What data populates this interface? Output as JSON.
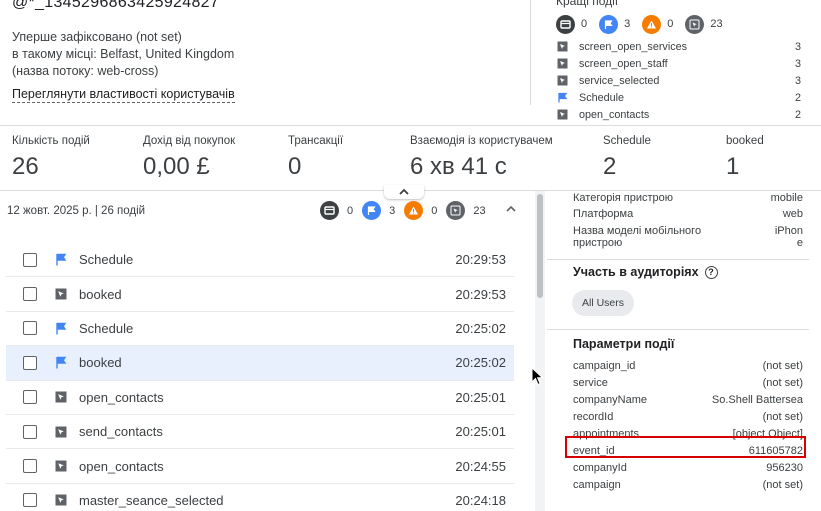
{
  "profile": {
    "user_id": "@*_1345296863425924827",
    "first_seen_line1": "Уперше зафіксовано (not set)",
    "first_seen_line2": "в такому місці: Belfast, United Kingdom",
    "first_seen_line3": "(назва потоку: web-cross)",
    "view_properties_link": "Переглянути властивості користувачів"
  },
  "top_events": {
    "title": "Кращі події",
    "counters": [
      {
        "icon": "screen-icon",
        "value": "0"
      },
      {
        "icon": "flag-icon",
        "value": "3"
      },
      {
        "icon": "warning-icon",
        "value": "0"
      },
      {
        "icon": "cursor-icon",
        "value": "23"
      }
    ],
    "items": [
      {
        "icon": "cursor-icon",
        "name": "screen_open_services",
        "count": "3"
      },
      {
        "icon": "cursor-icon",
        "name": "screen_open_staff",
        "count": "3"
      },
      {
        "icon": "cursor-icon",
        "name": "service_selected",
        "count": "3"
      },
      {
        "icon": "flag-icon",
        "name": "Schedule",
        "count": "2"
      },
      {
        "icon": "cursor-icon",
        "name": "open_contacts",
        "count": "2"
      }
    ]
  },
  "metrics": [
    {
      "label": "Кількість подій",
      "value": "26"
    },
    {
      "label": "Дохід від покупок",
      "value": "0,00 £"
    },
    {
      "label": "Трансакції",
      "value": "0"
    },
    {
      "label": "Взаємодія із користувачем",
      "value": "6 хв 41 с"
    },
    {
      "label": "Schedule",
      "value": "2"
    },
    {
      "label": "booked",
      "value": "1"
    }
  ],
  "events": {
    "date_header": "12 жовт. 2025 р. | 26 подій",
    "counters": [
      {
        "icon": "screen-icon",
        "value": "0"
      },
      {
        "icon": "flag-icon",
        "value": "3"
      },
      {
        "icon": "warning-icon",
        "value": "0"
      },
      {
        "icon": "cursor-icon",
        "value": "23"
      }
    ],
    "rows": [
      {
        "icon": "flag-icon",
        "name": "Schedule",
        "time": "20:29:53",
        "selected": false
      },
      {
        "icon": "cursor-icon",
        "name": "booked",
        "time": "20:29:53",
        "selected": false
      },
      {
        "icon": "flag-icon",
        "name": "Schedule",
        "time": "20:25:02",
        "selected": false
      },
      {
        "icon": "flag-icon",
        "name": "booked",
        "time": "20:25:02",
        "selected": true
      },
      {
        "icon": "cursor-icon",
        "name": "open_contacts",
        "time": "20:25:01",
        "selected": false
      },
      {
        "icon": "cursor-icon",
        "name": "send_contacts",
        "time": "20:25:01",
        "selected": false
      },
      {
        "icon": "cursor-icon",
        "name": "open_contacts",
        "time": "20:24:55",
        "selected": false
      },
      {
        "icon": "cursor-icon",
        "name": "master_seance_selected",
        "time": "20:24:18",
        "selected": false
      }
    ]
  },
  "details": {
    "device": [
      {
        "key": "Категорія пристрою",
        "value": "mobile"
      },
      {
        "key": "Платформа",
        "value": "web"
      },
      {
        "key": "Назва моделі мобільного пристрою",
        "value": "iPhone"
      }
    ],
    "audience_title": "Участь в аудиторіях",
    "audience_chip": "All Users",
    "params_title": "Параметри події",
    "params": [
      {
        "key": "campaign_id",
        "value": "(not set)"
      },
      {
        "key": "service",
        "value": "(not set)"
      },
      {
        "key": "companyName",
        "value": "So.Shell Battersea"
      },
      {
        "key": "recordId",
        "value": "(not set)"
      },
      {
        "key": "appointments",
        "value": "[object Object]"
      },
      {
        "key": "event_id",
        "value": "611605782"
      },
      {
        "key": "companyId",
        "value": "956230"
      },
      {
        "key": "campaign",
        "value": "(not set)"
      }
    ]
  },
  "colors": {
    "flag": "#4285f4",
    "warning": "#f57c00",
    "dark": "#3c4043",
    "selected_row": "#e8f0fe",
    "highlight_border": "#d50000"
  }
}
